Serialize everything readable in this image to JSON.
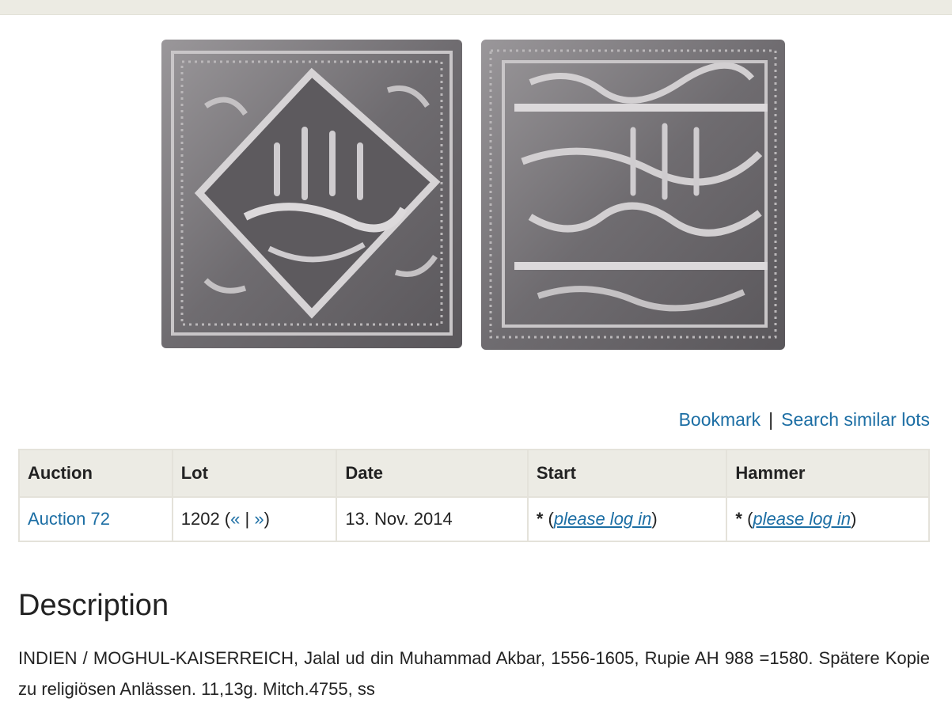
{
  "actions": {
    "bookmark_label": "Bookmark",
    "separator": "|",
    "search_similar_label": "Search similar lots"
  },
  "table": {
    "headers": {
      "auction": "Auction",
      "lot": "Lot",
      "date": "Date",
      "start": "Start",
      "hammer": "Hammer"
    },
    "row": {
      "auction": "Auction 72",
      "lot_number": "1202",
      "lot_prev": "«",
      "lot_sep": "|",
      "lot_next": "»",
      "date": "13. Nov. 2014",
      "start_prefix": "*",
      "start_login": "please log in",
      "hammer_prefix": "*",
      "hammer_login": "please log in"
    }
  },
  "description": {
    "heading": "Description",
    "text": "INDIEN / MOGHUL-KAISERREICH, Jalal ud din Muhammad Akbar, 1556-1605, Rupie AH 988 =1580. Spätere Kopie zu religiösen Anlässen. 11,13g. Mitch.4755, ss"
  },
  "colors": {
    "link": "#1c6ea4",
    "table_header_bg": "#ecebe4",
    "top_strip": "#ecebe3"
  }
}
